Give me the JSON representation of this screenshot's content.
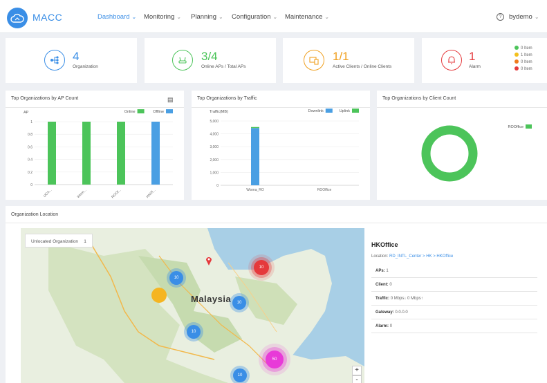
{
  "app": {
    "brand": "MACC"
  },
  "nav": {
    "items": [
      {
        "label": "Dashboard",
        "active": true
      },
      {
        "label": "Monitoring",
        "active": false
      },
      {
        "label": "Planning",
        "active": false
      },
      {
        "label": "Configuration",
        "active": false
      },
      {
        "label": "Maintenance",
        "active": false
      }
    ],
    "help_icon": "question-circle-icon",
    "user": "bydemo"
  },
  "stats": {
    "organization": {
      "value": "4",
      "label": "Organization",
      "icon": "organization-icon",
      "color": "#3a8ee6"
    },
    "aps": {
      "value": "3/4",
      "label": "Online APs / Total APs",
      "icon": "router-icon",
      "color": "#4cc45a"
    },
    "clients": {
      "value": "1/1",
      "label": "Active Clients / Online Clients",
      "icon": "devices-icon",
      "color": "#f0a020"
    },
    "alarm": {
      "value": "1",
      "label": "Alarm",
      "icon": "bell-icon",
      "color": "#e5393c",
      "levels": [
        {
          "text": "0 Item",
          "color": "#4cc45a"
        },
        {
          "text": "1 Item",
          "color": "#f3c01c"
        },
        {
          "text": "0 Item",
          "color": "#f07a1c"
        },
        {
          "text": "0 Item",
          "color": "#e5393c"
        }
      ]
    }
  },
  "panels": {
    "ap_count": {
      "title": "Top Organizations by AP Count",
      "menu_icon": "menu-icon"
    },
    "traffic": {
      "title": "Top Organizations by Traffic"
    },
    "client_count": {
      "title": "Top Organizations by Client Count"
    }
  },
  "chart_data": [
    {
      "type": "bar",
      "title": "Top Organizations by AP Count",
      "ylabel": "AP",
      "ylim": [
        0,
        1
      ],
      "yticks": [
        "0",
        "0.2",
        "0.4",
        "0.6",
        "0.8",
        "1"
      ],
      "categories": [
        "UCA...",
        "Wism...",
        "ROOf...",
        "HKOf..."
      ],
      "series": [
        {
          "name": "Online",
          "color": "#4cc45a",
          "values": [
            1,
            1,
            1,
            0
          ]
        },
        {
          "name": "Offline",
          "color": "#4a9fe3",
          "values": [
            0,
            0,
            0,
            1
          ]
        }
      ],
      "legend": "top-right"
    },
    {
      "type": "bar",
      "title": "Top Organizations by Traffic",
      "ylabel": "Traffic(MB)",
      "ylim": [
        0,
        5000
      ],
      "yticks": [
        "0",
        "1,000",
        "2,000",
        "3,000",
        "4,000",
        "5,000"
      ],
      "categories": [
        "Wisma_RO",
        "ROOffice"
      ],
      "series": [
        {
          "name": "Downlink",
          "color": "#4a9fe3",
          "values": [
            4450,
            0
          ]
        },
        {
          "name": "Uplink",
          "color": "#4cc45a",
          "values": [
            80,
            0
          ]
        }
      ],
      "legend": "top-right"
    },
    {
      "type": "pie",
      "title": "Top Organizations by Client Count",
      "labels": [
        "ROOffice"
      ],
      "values": [
        1
      ],
      "colors": [
        "#4cc45a"
      ],
      "legend": "right"
    }
  ],
  "location": {
    "title": "Organization Location",
    "unlocated": "Unlocated Organization　 1",
    "map_label": "Malaysia",
    "clusters": [
      {
        "label": "10",
        "color": "#3a8ee6"
      },
      {
        "label": "10",
        "color": "#e5393c"
      },
      {
        "label": "10",
        "color": "#3a8ee6"
      },
      {
        "label": "10",
        "color": "#3a8ee6"
      },
      {
        "label": "50",
        "color": "#e83ad8"
      },
      {
        "label": "10",
        "color": "#3a8ee6"
      }
    ],
    "zoom_in": "+",
    "zoom_out": "-",
    "detail": {
      "name": "HKOffice",
      "location_label": "Location:",
      "location_value": "RD_INTL_Center > HK > HKOffice",
      "rows": [
        {
          "label": "APs:",
          "value": "1"
        },
        {
          "label": "Client:",
          "value": "0"
        },
        {
          "label": "Traffic:",
          "value": "0 Mbps↓  0 Mbps↑"
        },
        {
          "label": "Gateway:",
          "value": "0.0.0.0"
        },
        {
          "label": "Alarm:",
          "value": "0"
        }
      ]
    }
  }
}
